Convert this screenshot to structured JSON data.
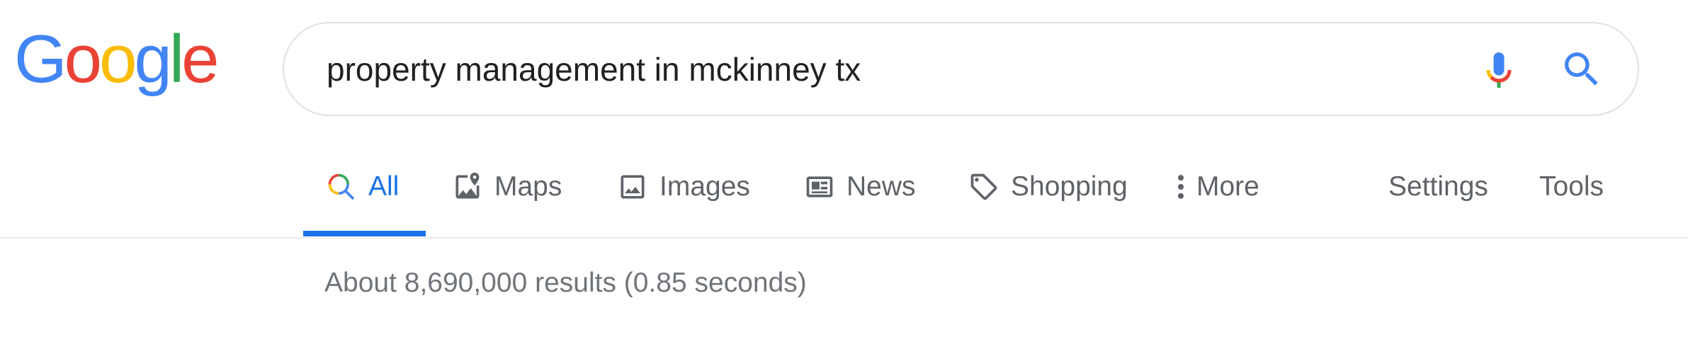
{
  "logo": {
    "letters": [
      "G",
      "o",
      "o",
      "g",
      "l",
      "e"
    ],
    "colors": [
      "#4285F4",
      "#EA4335",
      "#FBBC05",
      "#4285F4",
      "#34A853",
      "#EA4335"
    ]
  },
  "search": {
    "query": "property management in mckinney tx",
    "mic_icon": "microphone-icon",
    "search_icon": "magnifier-icon"
  },
  "tabs": [
    {
      "label": "All",
      "icon": "search-multicolor-icon",
      "active": true
    },
    {
      "label": "Maps",
      "icon": "map-pin-icon",
      "active": false
    },
    {
      "label": "Images",
      "icon": "image-icon",
      "active": false
    },
    {
      "label": "News",
      "icon": "newspaper-icon",
      "active": false
    },
    {
      "label": "Shopping",
      "icon": "tag-icon",
      "active": false
    },
    {
      "label": "More",
      "icon": "vertical-dots-icon",
      "active": false
    }
  ],
  "tools": {
    "settings_label": "Settings",
    "tools_label": "Tools"
  },
  "result_stats": "About 8,690,000 results (0.85 seconds)",
  "colors": {
    "accent": "#1a73e8",
    "text_secondary": "#5f6368",
    "stats_text": "#70757a"
  }
}
